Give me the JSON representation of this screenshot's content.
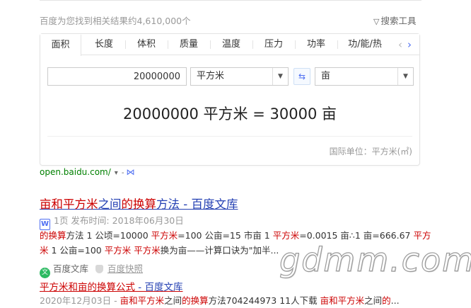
{
  "header": {
    "result_count": "百度为您找到相关结果约4,610,000个",
    "search_tools": "搜索工具"
  },
  "converter": {
    "tabs": [
      {
        "label": "面积"
      },
      {
        "label": "长度"
      },
      {
        "label": "体积"
      },
      {
        "label": "质量"
      },
      {
        "label": "温度"
      },
      {
        "label": "压力"
      },
      {
        "label": "功率"
      },
      {
        "label": "功/能/热"
      }
    ],
    "active_tab": "面积",
    "input_value": "20000000",
    "from_unit": "平方米",
    "to_unit": "亩",
    "result": "20000000 平方米 = 30000 亩",
    "unit_note": "国际单位：平方米(㎡)"
  },
  "source_url": "open.baidu.com/",
  "result1": {
    "title_parts": [
      {
        "text": "亩和平方米",
        "hl": true
      },
      {
        "text": "之间",
        "hl": false
      },
      {
        "text": "的换算",
        "hl": true
      },
      {
        "text": "方法 - 百度文库",
        "hl": false
      }
    ],
    "meta": "1页 发布时间: 2018年06月30日",
    "doc_icon": "W",
    "snippet_parts": [
      {
        "text": "的换算",
        "hl": true
      },
      {
        "text": "方法 1 公顷=10000 ",
        "hl": false
      },
      {
        "text": "平方米",
        "hl": true
      },
      {
        "text": "=100 公亩=15 市亩 1 ",
        "hl": false
      },
      {
        "text": "平方米",
        "hl": true
      },
      {
        "text": "=0.0015 亩∴1 亩=666.67 ",
        "hl": false
      },
      {
        "text": "平方米",
        "hl": true
      },
      {
        "text": " 1 公亩=100 ",
        "hl": false
      },
      {
        "text": "平方米 平方米",
        "hl": true
      },
      {
        "text": "换为亩——计算口诀为\"加半...",
        "hl": false
      }
    ],
    "site_name": "百度文库",
    "site_icon": "文",
    "snapshot": "百度快照"
  },
  "result2": {
    "title_hl": "平方米和亩的换算公式",
    "title_rest": " - 百度文库",
    "date": "2020年12月03日 - ",
    "snippet_parts": [
      {
        "text": "亩和平方米",
        "hl": true
      },
      {
        "text": "之间",
        "hl": false
      },
      {
        "text": "的换算",
        "hl": true
      },
      {
        "text": "方法704244973 11人下载 ",
        "hl": false
      },
      {
        "text": "亩和平方米",
        "hl": true
      },
      {
        "text": "之间",
        "hl": false
      },
      {
        "text": "的",
        "hl": true
      },
      {
        "text": "...",
        "hl": false
      }
    ]
  },
  "watermark": "gdmm.com",
  "icons": {
    "filter": "funnel-icon",
    "swap": "swap-icon",
    "prev": "chevron-left-icon",
    "next": "chevron-right-icon"
  },
  "colors": {
    "link": "#2440b3",
    "highlight": "#cc0000",
    "url": "#008000",
    "accent": "#4e6ef2"
  }
}
